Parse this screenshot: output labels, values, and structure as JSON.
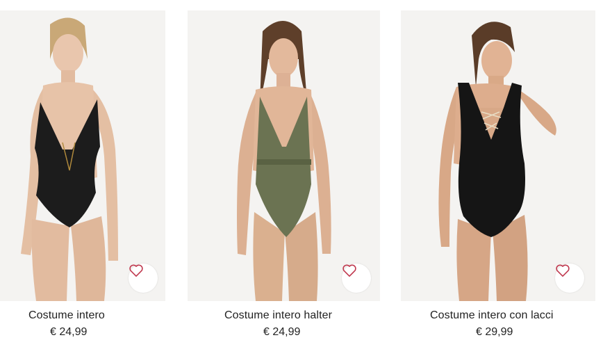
{
  "products": [
    {
      "name": "Costume intero",
      "price": "€ 24,99",
      "image_alt": "model-black-cutout-swimsuit",
      "swimsuit_color": "#1c1c1c",
      "favorite_icon": "heart-outline-icon"
    },
    {
      "name": "Costume intero halter",
      "price": "€ 24,99",
      "image_alt": "model-khaki-halter-swimsuit",
      "swimsuit_color": "#6b7352",
      "favorite_icon": "heart-outline-icon"
    },
    {
      "name": "Costume intero con lacci",
      "price": "€ 29,99",
      "image_alt": "model-black-lace-up-swimsuit",
      "swimsuit_color": "#151515",
      "favorite_icon": "heart-outline-icon"
    }
  ],
  "colors": {
    "background": "#ffffff",
    "photo_background": "#f4f3f1",
    "heart": "#c0394f",
    "text": "#222222"
  }
}
